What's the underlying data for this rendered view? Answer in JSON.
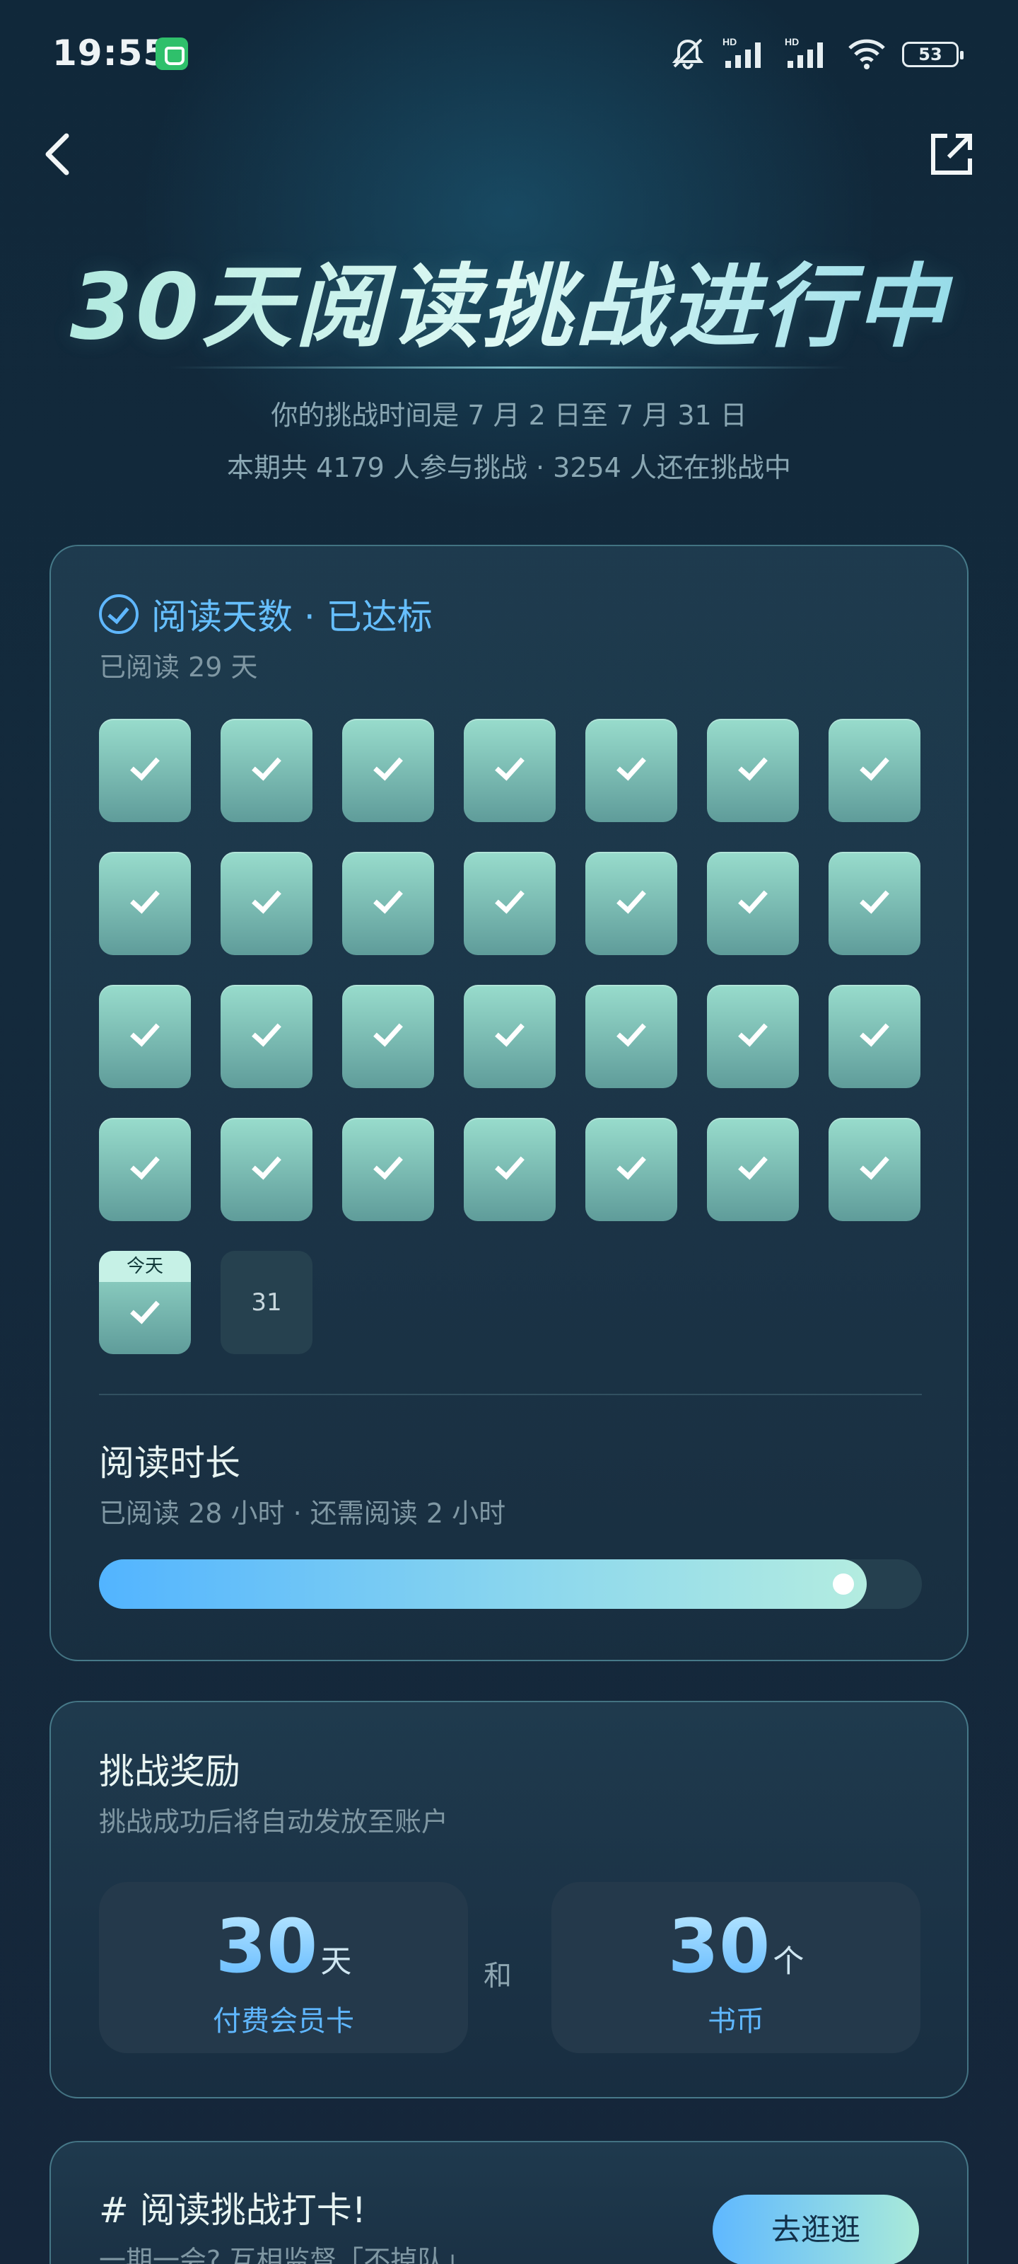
{
  "status_bar": {
    "time": "19:55",
    "battery": "53",
    "network_1": "HD",
    "network_2": "HD"
  },
  "nav": {
    "back_icon": "chevron-left-icon",
    "share_icon": "share-external-icon"
  },
  "hero": {
    "title": "30天阅读挑战进行中",
    "period": "你的挑战时间是 7 月 2 日至 7 月 31 日",
    "participants": "本期共 4179 人参与挑战 · 3254 人还在挑战中"
  },
  "reading_days": {
    "title": "阅读天数 · 已达标",
    "subtitle": "已阅读 29 天",
    "today_label": "今天",
    "pending_day": "31",
    "completed_count": 29
  },
  "reading_time": {
    "title": "阅读时长",
    "subtitle": "已阅读 28 小时 · 还需阅读 2 小时",
    "progress": 0.933
  },
  "rewards": {
    "title": "挑战奖励",
    "subtitle": "挑战成功后将自动发放至账户",
    "and_label": "和",
    "items": [
      {
        "value": "30",
        "unit": "天",
        "label": "付费会员卡"
      },
      {
        "value": "30",
        "unit": "个",
        "label": "书币"
      }
    ]
  },
  "checkin": {
    "title": "# 阅读挑战打卡!",
    "subtitle": "一期一会? 互相监督「不掉队」",
    "button": "去逛逛"
  },
  "colors": {
    "accent_blue": "#5fb7ff",
    "mint": "#98dccc",
    "background": "#142a3c"
  }
}
